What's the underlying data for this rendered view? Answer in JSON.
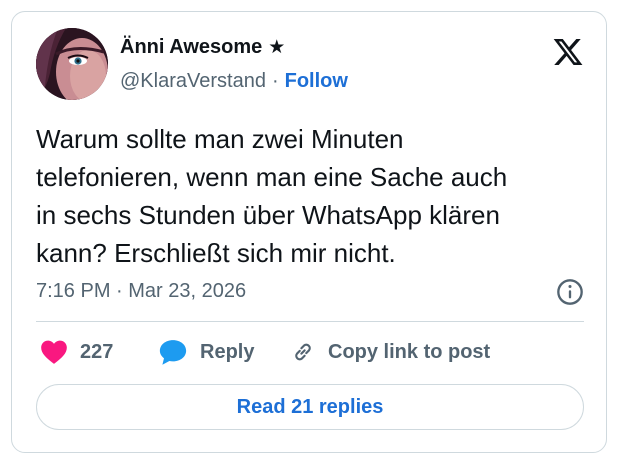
{
  "author": {
    "display_name": "Änni Awesome",
    "badge_icon": "star-icon",
    "badge_glyph": "★",
    "handle": "@KlaraVerstand",
    "separator": "·",
    "follow_label": "Follow"
  },
  "brand_icon": "x-logo-icon",
  "tweet": {
    "text": "Warum sollte man zwei Minuten\ntelefonieren, wenn man eine Sache auch\nin sechs Stunden über WhatsApp klären\nkann? Erschließt sich mir nicht.",
    "timestamp": "7:16 PM · Mar 23, 2026"
  },
  "actions": {
    "like_count": "227",
    "reply_label": "Reply",
    "copy_link_label": "Copy link to post"
  },
  "read_replies_label": "Read 21 replies",
  "colors": {
    "link": "#1d6fd6",
    "heart": "#f91880",
    "reply_icon": "#1d9bf0",
    "muted": "#536471",
    "border": "#cfd9de"
  }
}
